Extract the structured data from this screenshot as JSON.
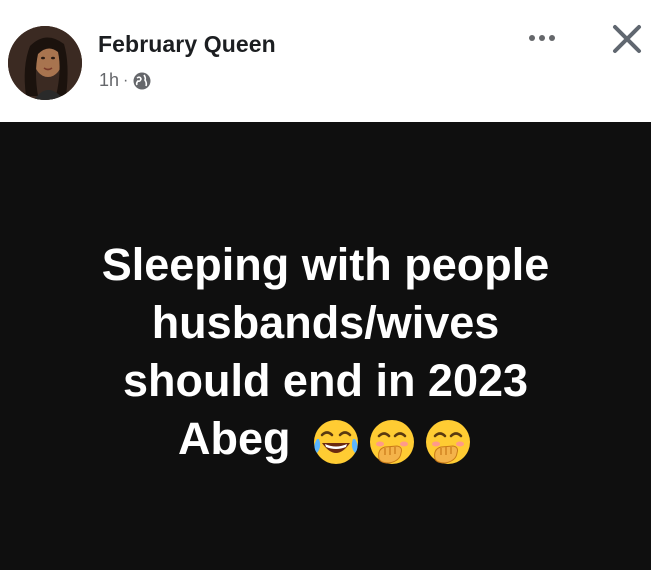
{
  "post": {
    "author_name": "February Queen",
    "time_ago": "1h",
    "separator": "·",
    "privacy_icon": "globe-icon",
    "more_icon": "more-dots-icon",
    "close_icon": "close-icon",
    "text_lines": [
      "Sleeping with people",
      "husbands/wives",
      "should end in 2023",
      "Abeg"
    ],
    "emojis": [
      "tears-of-joy-emoji",
      "face-with-hand-over-mouth-emoji",
      "face-with-hand-over-mouth-emoji"
    ]
  },
  "colors": {
    "header_bg": "#ffffff",
    "body_bg": "#0f0f0f",
    "text": "#ffffff",
    "name": "#1c1e21",
    "meta": "#65676b"
  }
}
